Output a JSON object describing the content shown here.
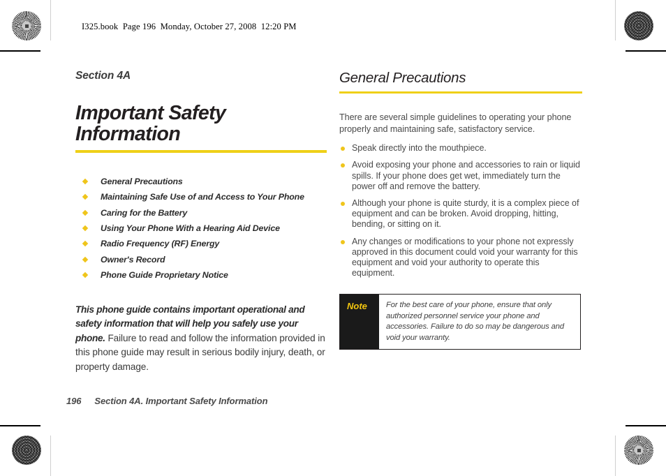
{
  "print_header": "I325.book  Page 196  Monday, October 27, 2008  12:20 PM",
  "colors": {
    "accent_yellow": "#efd018",
    "bullet_yellow": "#efc51b",
    "note_tag_bg": "#1a1a1a",
    "note_tag_text": "#f2c50f",
    "body_text": "#4a4a4a"
  },
  "left_column": {
    "section_label": "Section 4A",
    "chapter_title": "Important Safety Information",
    "toc": [
      "General Precautions",
      "Maintaining Safe Use of and Access to Your Phone",
      "Caring for the Battery",
      "Using Your Phone With a Hearing Aid Device",
      "Radio Frequency (RF) Energy",
      "Owner's Record",
      "Phone Guide Proprietary Notice"
    ],
    "intro_lead": "This phone guide contains important operational and safety information that will help you safely use your phone.",
    "intro_rest": " Failure to read and follow the information provided in this phone guide may result in serious bodily injury, death, or property damage."
  },
  "right_column": {
    "heading": "General Precautions",
    "intro": "There are several simple guidelines to operating your phone properly and maintaining safe, satisfactory service.",
    "bullets": [
      "Speak directly into the mouthpiece.",
      "Avoid exposing your phone and accessories to rain or liquid spills. If your phone does get wet, immediately turn the power off and remove the battery.",
      "Although your phone is quite sturdy, it is a complex piece of equipment and can be broken. Avoid dropping, hitting, bending, or sitting on it.",
      "Any changes or modifications to your phone not expressly approved in this document could void your warranty for this equipment and void your authority to operate this equipment."
    ],
    "note": {
      "label": "Note",
      "text": "For the best care of your phone, ensure that only authorized personnel service your phone and accessories. Failure to do so may be dangerous and void your warranty."
    }
  },
  "footer": {
    "page_number": "196",
    "running_title": "Section 4A. Important Safety Information"
  }
}
